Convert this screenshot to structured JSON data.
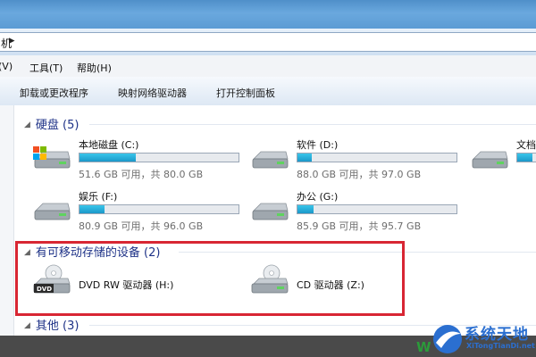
{
  "address": {
    "path_fragment": "机",
    "arrow": "▸"
  },
  "menu": [
    {
      "label": "(V)"
    },
    {
      "label": "工具(T)"
    },
    {
      "label": "帮助(H)"
    }
  ],
  "toolbar": [
    {
      "label": "卸载或更改程序"
    },
    {
      "label": "映射网络驱动器"
    },
    {
      "label": "打开控制面板"
    }
  ],
  "groups": {
    "hard_disks": {
      "title": "硬盘 (5)"
    },
    "removable": {
      "title": "有可移动存储的设备 (2)"
    },
    "other": {
      "title": "其他 (3)"
    }
  },
  "drives": [
    {
      "name": "本地磁盘 (C:)",
      "space": "51.6 GB 可用，共 80.0 GB",
      "used_fraction": 0.355
    },
    {
      "name": "软件 (D:)",
      "space": "88.0 GB 可用，共 97.0 GB",
      "used_fraction": 0.09
    },
    {
      "name": "文档",
      "space": "",
      "used_fraction": 0.3
    },
    {
      "name": "娱乐 (F:)",
      "space": "80.9 GB 可用，共 96.0 GB",
      "used_fraction": 0.16
    },
    {
      "name": "办公 (G:)",
      "space": "85.9 GB 可用，共 95.7 GB",
      "used_fraction": 0.1
    }
  ],
  "removable_drives": [
    {
      "name": "DVD RW 驱动器 (H:)",
      "badge": "DVD"
    },
    {
      "name": "CD 驱动器 (Z:)"
    }
  ],
  "watermark": {
    "text": "系统天地",
    "sub": "XiTongTianDi.net",
    "left_letter": "W"
  },
  "colors": {
    "accent": "#1e3287",
    "highlight": "#d82633",
    "bar_fill": "#26b0dd"
  }
}
